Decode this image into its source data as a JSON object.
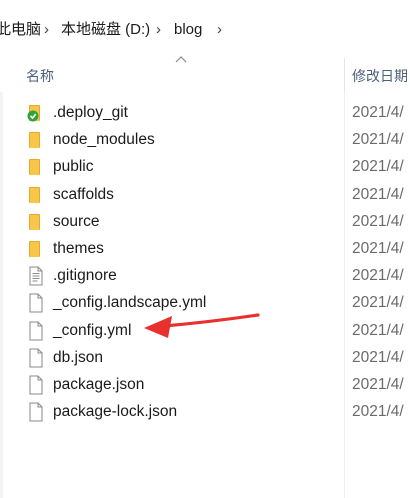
{
  "breadcrumb": {
    "items": [
      "此电脑",
      "本地磁盘 (D:)",
      "blog"
    ]
  },
  "columns": {
    "name": "名称",
    "date": "修改日期"
  },
  "files": [
    {
      "name": ".deploy_git",
      "type": "folder-synced",
      "date": "2021/4/"
    },
    {
      "name": "node_modules",
      "type": "folder",
      "date": "2021/4/"
    },
    {
      "name": "public",
      "type": "folder",
      "date": "2021/4/"
    },
    {
      "name": "scaffolds",
      "type": "folder",
      "date": "2021/4/"
    },
    {
      "name": "source",
      "type": "folder",
      "date": "2021/4/"
    },
    {
      "name": "themes",
      "type": "folder",
      "date": "2021/4/"
    },
    {
      "name": ".gitignore",
      "type": "text-file",
      "date": "2021/4/"
    },
    {
      "name": "_config.landscape.yml",
      "type": "file",
      "date": "2021/4/"
    },
    {
      "name": "_config.yml",
      "type": "file",
      "date": "2021/4/"
    },
    {
      "name": "db.json",
      "type": "file",
      "date": "2021/4/"
    },
    {
      "name": "package.json",
      "type": "file",
      "date": "2021/4/"
    },
    {
      "name": "package-lock.json",
      "type": "file",
      "date": "2021/4/"
    }
  ],
  "colors": {
    "folder": "#f8c74a",
    "folder_dark": "#e6a92a",
    "sync_badge": "#2fa23a",
    "annotation_arrow": "#e8312f"
  },
  "annotation": {
    "target": "_config.yml"
  }
}
